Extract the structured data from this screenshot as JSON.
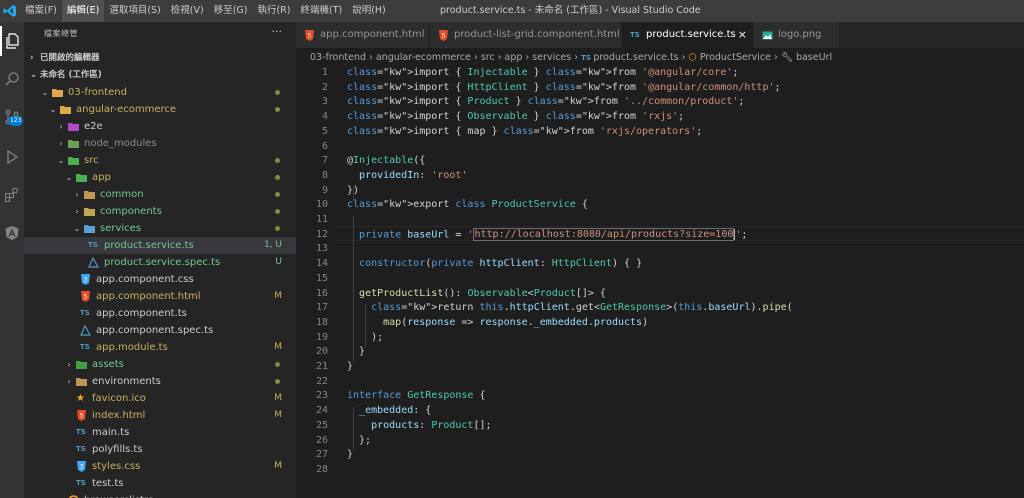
{
  "menu": {
    "items": [
      "檔案(F)",
      "編輯(E)",
      "選取項目(S)",
      "檢視(V)",
      "移至(G)",
      "執行(R)",
      "終端機(T)",
      "說明(H)"
    ]
  },
  "window_title": "product.service.ts - 未命名 (工作區) - Visual Studio Code",
  "activity": {
    "scm_badge": "123"
  },
  "sidebar": {
    "title": "檔案總管",
    "more": "···",
    "open_editors_label": "已開啟的編輯器",
    "workspace_label": "未命名 (工作區)",
    "tree": [
      {
        "label": "03-frontend",
        "status": "dot"
      },
      {
        "label": "angular-ecommerce",
        "status": "dot"
      },
      {
        "label": "e2e",
        "status": ""
      },
      {
        "label": "node_modules",
        "status": ""
      },
      {
        "label": "src",
        "status": "dot"
      },
      {
        "label": "app",
        "status": "dot"
      },
      {
        "label": "common",
        "status": "dot"
      },
      {
        "label": "components",
        "status": "dot"
      },
      {
        "label": "services",
        "status": "dot"
      },
      {
        "label": "product.service.ts",
        "status": "1, U"
      },
      {
        "label": "product.service.spec.ts",
        "status": "U"
      },
      {
        "label": "app.component.css",
        "status": ""
      },
      {
        "label": "app.component.html",
        "status": "M"
      },
      {
        "label": "app.component.ts",
        "status": ""
      },
      {
        "label": "app.component.spec.ts",
        "status": ""
      },
      {
        "label": "app.module.ts",
        "status": "M"
      },
      {
        "label": "assets",
        "status": "dot"
      },
      {
        "label": "environments",
        "status": "dot"
      },
      {
        "label": "favicon.ico",
        "status": "M"
      },
      {
        "label": "index.html",
        "status": "M"
      },
      {
        "label": "main.ts",
        "status": ""
      },
      {
        "label": "polyfills.ts",
        "status": ""
      },
      {
        "label": "styles.css",
        "status": "M"
      },
      {
        "label": "test.ts",
        "status": ""
      },
      {
        "label": "browserslistrc",
        "status": ""
      }
    ]
  },
  "tabs": [
    {
      "label": "app.component.html",
      "icon": "html-icon"
    },
    {
      "label": "product-list-grid.component.html",
      "icon": "html-icon"
    },
    {
      "label": "product.service.ts",
      "icon": "ts-icon",
      "close": "×"
    },
    {
      "label": "logo.png",
      "icon": "image-icon"
    }
  ],
  "breadcrumb": [
    "03-frontend",
    "angular-ecommerce",
    "src",
    "app",
    "services",
    "product.service.ts",
    "ProductService",
    "baseUrl"
  ],
  "code": {
    "line_numbers": [
      "1",
      "2",
      "3",
      "4",
      "5",
      "6",
      "7",
      "8",
      "9",
      "10",
      "11",
      "12",
      "13",
      "14",
      "15",
      "16",
      "17",
      "18",
      "19",
      "20",
      "21",
      "22",
      "23",
      "24",
      "25",
      "26",
      "27",
      "28"
    ],
    "lines": [
      "import { Injectable } from '@angular/core';",
      "import { HttpClient } from '@angular/common/http';",
      "import { Product } from '../common/product';",
      "import { Observable } from 'rxjs';",
      "import { map } from 'rxjs/operators';",
      "",
      "@Injectable({",
      "  providedIn: 'root'",
      "})",
      "export class ProductService {",
      "",
      "  private baseUrl = 'http://localhost:8080/api/products?size=100';",
      "",
      "  constructor(private httpClient: HttpClient) { }",
      "",
      "  getProductList(): Observable<Product[]> {",
      "    return this.httpClient.get<GetResponse>(this.baseUrl).pipe(",
      "      map(response => response._embedded.products)",
      "    );",
      "  }",
      "}",
      "",
      "interface GetResponse {",
      "  _embedded: {",
      "    products: Product[];",
      "  };",
      "}",
      ""
    ]
  },
  "colors": {
    "keyword": "#c586c0",
    "string": "#ce9178",
    "type": "#4ec9b0",
    "function": "#dcdcaa",
    "variable": "#9cdcfe",
    "storage": "#569cd6",
    "untracked": "#73c991",
    "modified": "#c7b15f",
    "accent": "#007acc"
  }
}
